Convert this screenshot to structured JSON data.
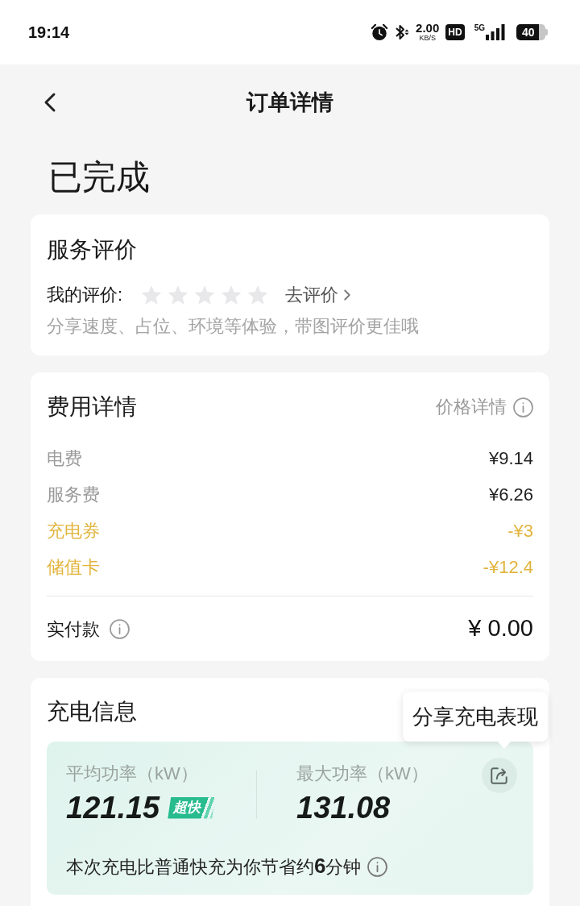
{
  "status_bar": {
    "time": "19:14",
    "speed": "2.00",
    "speed_unit": "KB/S",
    "hd": "HD",
    "network": "5G",
    "battery": "40"
  },
  "header": {
    "title": "订单详情"
  },
  "order_status": "已完成",
  "rating": {
    "title": "服务评价",
    "label": "我的评价:",
    "stars": 0,
    "action": "去评价",
    "hint": "分享速度、占位、环境等体验，带图评价更佳哦"
  },
  "fees": {
    "title": "费用详情",
    "details_link": "价格详情",
    "items": [
      {
        "label": "电费",
        "amount": "¥9.14",
        "kind": "charge"
      },
      {
        "label": "服务费",
        "amount": "¥6.26",
        "kind": "charge"
      },
      {
        "label": "充电券",
        "amount": "-¥3",
        "kind": "discount"
      },
      {
        "label": "储值卡",
        "amount": "-¥12.4",
        "kind": "discount"
      }
    ],
    "total": {
      "label": "实付款",
      "amount": "¥ 0.00"
    }
  },
  "charging": {
    "title": "充电信息",
    "tooltip": "分享充电表现",
    "metrics": [
      {
        "label": "平均功率（kW）",
        "value": "121.15",
        "tag": "超快"
      },
      {
        "label": "最大功率（kW）",
        "value": "131.08"
      }
    ],
    "note": "本次充电比普通快充为你节省约**6**分钟"
  }
}
